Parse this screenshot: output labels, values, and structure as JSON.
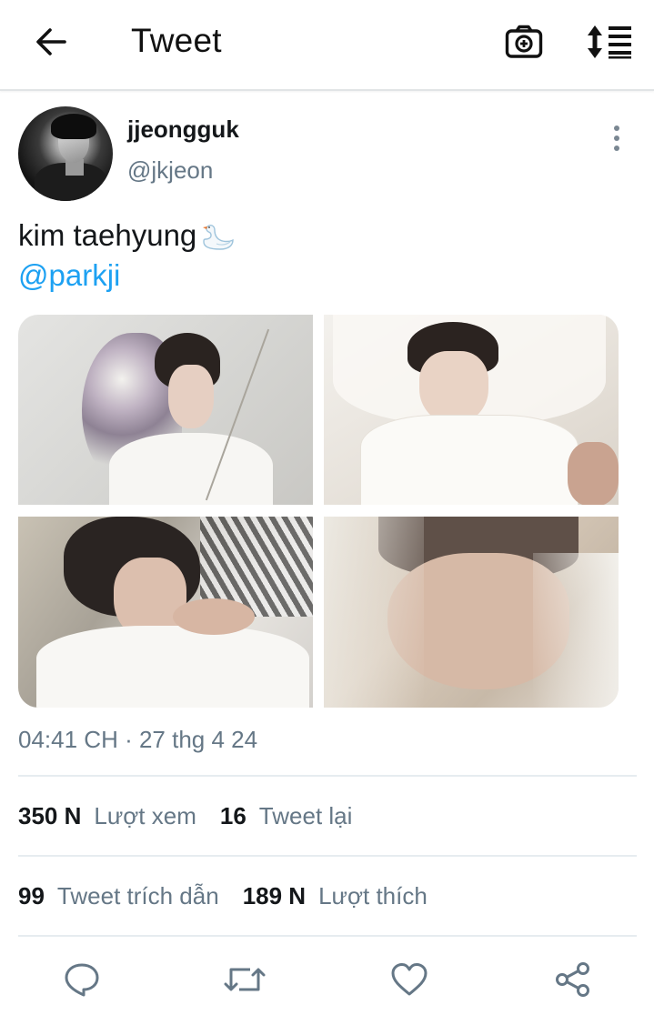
{
  "header": {
    "title": "Tweet",
    "back_icon": "arrow-left-icon",
    "camera_icon": "camera-add-icon",
    "sort_icon": "sort-list-icon"
  },
  "tweet": {
    "author": {
      "display_name": "jjeongguk",
      "handle": "@jkjeon"
    },
    "text": "kim taehyung",
    "emoji": "swan-icon",
    "mention": "@parkji",
    "media_count": 4,
    "timestamp": "04:41 CH · 27 thg 4 24"
  },
  "stats": {
    "views": {
      "value": "350 N",
      "label": "Lượt xem"
    },
    "retweets": {
      "value": "16",
      "label": "Tweet lại"
    },
    "quotes": {
      "value": "99",
      "label": "Tweet trích dẫn"
    },
    "likes": {
      "value": "189 N",
      "label": "Lượt thích"
    }
  },
  "actions": [
    "reply-icon",
    "retweet-icon",
    "like-icon",
    "share-icon"
  ],
  "colors": {
    "link": "#1da1f2",
    "secondary_text": "#657786",
    "primary_text": "#14171a",
    "divider": "#e6ecf0"
  }
}
